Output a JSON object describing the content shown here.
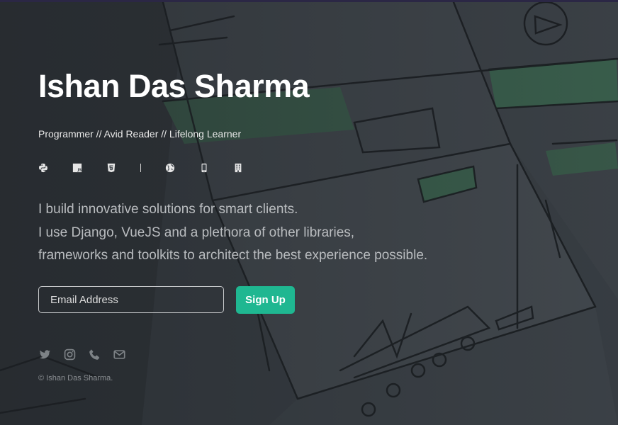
{
  "hero": {
    "name": "Ishan Das Sharma",
    "tagline": "Programmer // Avid Reader // Lifelong Learner",
    "intro_lines": [
      "I build innovative solutions for smart clients.",
      "I use Django, VueJS and a plethora of other libraries,",
      "frameworks and toolkits to architect the best experience possible."
    ]
  },
  "tech_icons": [
    "python-icon",
    "javascript-icon",
    "html5-icon",
    "globe-icon",
    "mobile-icon",
    "building-icon"
  ],
  "signup": {
    "email_placeholder": "Email Address",
    "button_label": "Sign Up"
  },
  "social_icons": [
    "twitter-icon",
    "instagram-icon",
    "phone-icon",
    "mail-icon"
  ],
  "footer": {
    "copyright": "© Ishan Das Sharma."
  },
  "colors": {
    "accent": "#1fb791",
    "title": "#ffffff",
    "body_text": "#b9bcbf",
    "background": "#2b2f33"
  }
}
